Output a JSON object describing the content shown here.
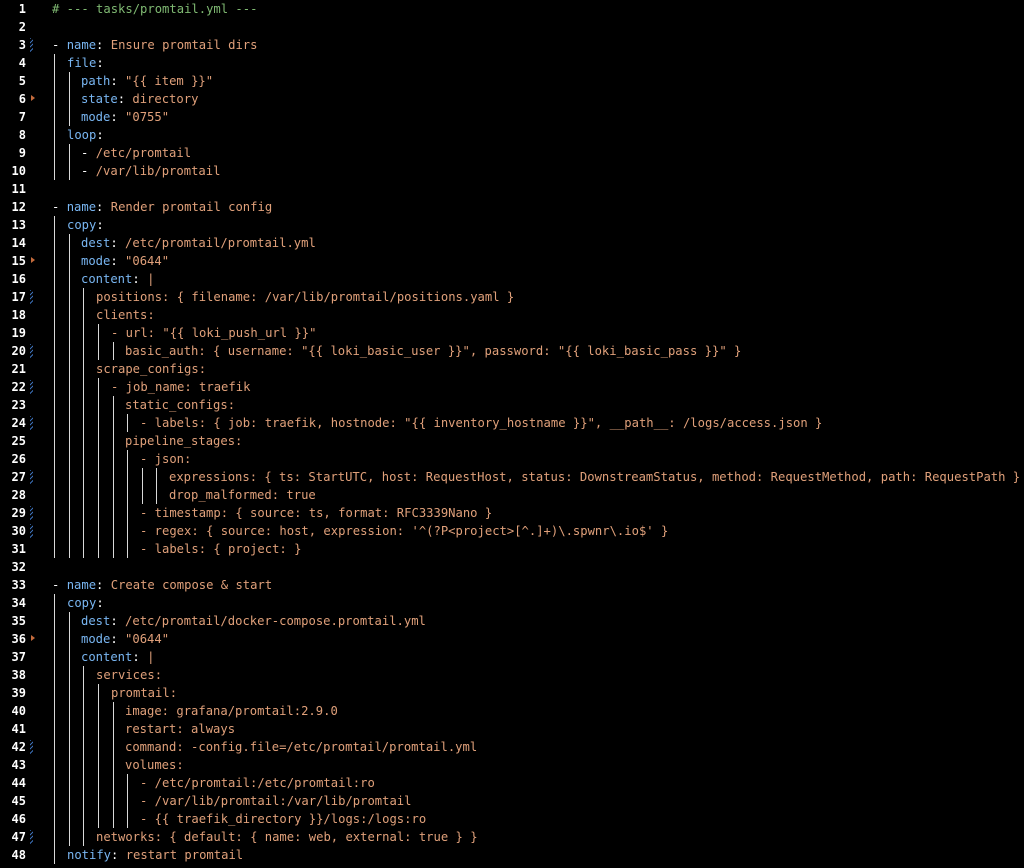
{
  "editor": {
    "file": "tasks/promtail.yml",
    "colors": {
      "background": "#000000",
      "line_number": "#ffffff",
      "comment": "#7fb972",
      "key": "#79b6f2",
      "string": "#e0a07a",
      "text": "#ffffff",
      "change_marker": "#3b6fb7",
      "fold_marker": "#c46b3c"
    },
    "lines": [
      {
        "n": "1",
        "indent": 0,
        "segs": [
          [
            "c",
            "# --- tasks/promtail.yml ---"
          ]
        ]
      },
      {
        "n": "2",
        "indent": 0,
        "segs": []
      },
      {
        "n": "3",
        "indent": 0,
        "mark": true,
        "segs": [
          [
            "d",
            "- "
          ],
          [
            "k",
            "name"
          ],
          [
            "p",
            ": "
          ],
          [
            "s",
            "Ensure promtail dirs"
          ]
        ]
      },
      {
        "n": "4",
        "indent": 1,
        "segs": [
          [
            "k",
            "file"
          ],
          [
            "p",
            ":"
          ]
        ]
      },
      {
        "n": "5",
        "indent": 2,
        "segs": [
          [
            "k",
            "path"
          ],
          [
            "p",
            ": "
          ],
          [
            "s",
            "\"{{ item }}\""
          ]
        ]
      },
      {
        "n": "6",
        "indent": 2,
        "fold": true,
        "segs": [
          [
            "k",
            "state"
          ],
          [
            "p",
            ": "
          ],
          [
            "s",
            "directory"
          ]
        ]
      },
      {
        "n": "7",
        "indent": 2,
        "segs": [
          [
            "k",
            "mode"
          ],
          [
            "p",
            ": "
          ],
          [
            "s",
            "\"0755\""
          ]
        ]
      },
      {
        "n": "8",
        "indent": 1,
        "segs": [
          [
            "k",
            "loop"
          ],
          [
            "p",
            ":"
          ]
        ]
      },
      {
        "n": "9",
        "indent": 2,
        "segs": [
          [
            "d",
            "- "
          ],
          [
            "s",
            "/etc/promtail"
          ]
        ]
      },
      {
        "n": "10",
        "indent": 2,
        "segs": [
          [
            "d",
            "- "
          ],
          [
            "s",
            "/var/lib/promtail"
          ]
        ]
      },
      {
        "n": "11",
        "indent": 0,
        "segs": []
      },
      {
        "n": "12",
        "indent": 0,
        "segs": [
          [
            "d",
            "- "
          ],
          [
            "k",
            "name"
          ],
          [
            "p",
            ": "
          ],
          [
            "s",
            "Render promtail config"
          ]
        ]
      },
      {
        "n": "13",
        "indent": 1,
        "segs": [
          [
            "k",
            "copy"
          ],
          [
            "p",
            ":"
          ]
        ]
      },
      {
        "n": "14",
        "indent": 2,
        "segs": [
          [
            "k",
            "dest"
          ],
          [
            "p",
            ": "
          ],
          [
            "s",
            "/etc/promtail/promtail.yml"
          ]
        ]
      },
      {
        "n": "15",
        "indent": 2,
        "fold": true,
        "segs": [
          [
            "k",
            "mode"
          ],
          [
            "p",
            ": "
          ],
          [
            "s",
            "\"0644\""
          ]
        ]
      },
      {
        "n": "16",
        "indent": 2,
        "segs": [
          [
            "k",
            "content"
          ],
          [
            "p",
            ": "
          ],
          [
            "s",
            "|"
          ]
        ]
      },
      {
        "n": "17",
        "indent": 3,
        "mark": true,
        "segs": [
          [
            "s",
            "positions: { filename: /var/lib/promtail/positions.yaml }"
          ]
        ]
      },
      {
        "n": "18",
        "indent": 3,
        "segs": [
          [
            "s",
            "clients:"
          ]
        ]
      },
      {
        "n": "19",
        "indent": 4,
        "segs": [
          [
            "s",
            "- url: \"{{ loki_push_url }}\""
          ]
        ]
      },
      {
        "n": "20",
        "indent": 5,
        "mark": true,
        "segs": [
          [
            "s",
            "basic_auth: { username: \"{{ loki_basic_user }}\", password: \"{{ loki_basic_pass }}\" }"
          ]
        ]
      },
      {
        "n": "21",
        "indent": 3,
        "segs": [
          [
            "s",
            "scrape_configs:"
          ]
        ]
      },
      {
        "n": "22",
        "indent": 4,
        "mark": true,
        "segs": [
          [
            "s",
            "- job_name: traefik"
          ]
        ]
      },
      {
        "n": "23",
        "indent": 5,
        "segs": [
          [
            "s",
            "static_configs:"
          ]
        ]
      },
      {
        "n": "24",
        "indent": 6,
        "mark": true,
        "segs": [
          [
            "s",
            "- labels: { job: traefik, hostnode: \"{{ inventory_hostname }}\", __path__: /logs/access.json }"
          ]
        ]
      },
      {
        "n": "25",
        "indent": 5,
        "segs": [
          [
            "s",
            "pipeline_stages:"
          ]
        ]
      },
      {
        "n": "26",
        "indent": 6,
        "segs": [
          [
            "s",
            "- json:"
          ]
        ]
      },
      {
        "n": "27",
        "indent": 8,
        "mark": true,
        "segs": [
          [
            "s",
            "expressions: { ts: StartUTC, host: RequestHost, status: DownstreamStatus, method: RequestMethod, path: RequestPath }"
          ]
        ]
      },
      {
        "n": "28",
        "indent": 8,
        "segs": [
          [
            "s",
            "drop_malformed: true"
          ]
        ]
      },
      {
        "n": "29",
        "indent": 6,
        "mark": true,
        "segs": [
          [
            "s",
            "- timestamp: { source: ts, format: RFC3339Nano }"
          ]
        ]
      },
      {
        "n": "30",
        "indent": 6,
        "mark": true,
        "segs": [
          [
            "s",
            "- regex: { source: host, expression: '^(?P<project>[^.]+)\\.spwnr\\.io$' }"
          ]
        ]
      },
      {
        "n": "31",
        "indent": 6,
        "segs": [
          [
            "s",
            "- labels: { project: }"
          ]
        ]
      },
      {
        "n": "32",
        "indent": 0,
        "segs": []
      },
      {
        "n": "33",
        "indent": 0,
        "segs": [
          [
            "d",
            "- "
          ],
          [
            "k",
            "name"
          ],
          [
            "p",
            ": "
          ],
          [
            "s",
            "Create compose & start"
          ]
        ]
      },
      {
        "n": "34",
        "indent": 1,
        "segs": [
          [
            "k",
            "copy"
          ],
          [
            "p",
            ":"
          ]
        ]
      },
      {
        "n": "35",
        "indent": 2,
        "segs": [
          [
            "k",
            "dest"
          ],
          [
            "p",
            ": "
          ],
          [
            "s",
            "/etc/promtail/docker-compose.promtail.yml"
          ]
        ]
      },
      {
        "n": "36",
        "indent": 2,
        "fold": true,
        "segs": [
          [
            "k",
            "mode"
          ],
          [
            "p",
            ": "
          ],
          [
            "s",
            "\"0644\""
          ]
        ]
      },
      {
        "n": "37",
        "indent": 2,
        "segs": [
          [
            "k",
            "content"
          ],
          [
            "p",
            ": "
          ],
          [
            "s",
            "|"
          ]
        ]
      },
      {
        "n": "38",
        "indent": 3,
        "segs": [
          [
            "s",
            "services:"
          ]
        ]
      },
      {
        "n": "39",
        "indent": 4,
        "segs": [
          [
            "s",
            "promtail:"
          ]
        ]
      },
      {
        "n": "40",
        "indent": 5,
        "segs": [
          [
            "s",
            "image: grafana/promtail:2.9.0"
          ]
        ]
      },
      {
        "n": "41",
        "indent": 5,
        "segs": [
          [
            "s",
            "restart: always"
          ]
        ]
      },
      {
        "n": "42",
        "indent": 5,
        "mark": true,
        "segs": [
          [
            "s",
            "command: -config.file=/etc/promtail/promtail.yml"
          ]
        ]
      },
      {
        "n": "43",
        "indent": 5,
        "segs": [
          [
            "s",
            "volumes:"
          ]
        ]
      },
      {
        "n": "44",
        "indent": 6,
        "segs": [
          [
            "s",
            "- /etc/promtail:/etc/promtail:ro"
          ]
        ]
      },
      {
        "n": "45",
        "indent": 6,
        "segs": [
          [
            "s",
            "- /var/lib/promtail:/var/lib/promtail"
          ]
        ]
      },
      {
        "n": "46",
        "indent": 6,
        "segs": [
          [
            "s",
            "- {{ traefik_directory }}/logs:/logs:ro"
          ]
        ]
      },
      {
        "n": "47",
        "indent": 3,
        "mark": true,
        "segs": [
          [
            "s",
            "networks: { default: { name: web, external: true } }"
          ]
        ]
      },
      {
        "n": "48",
        "indent": 1,
        "segs": [
          [
            "k",
            "notify"
          ],
          [
            "p",
            ": "
          ],
          [
            "s",
            "restart promtail"
          ]
        ]
      }
    ]
  }
}
